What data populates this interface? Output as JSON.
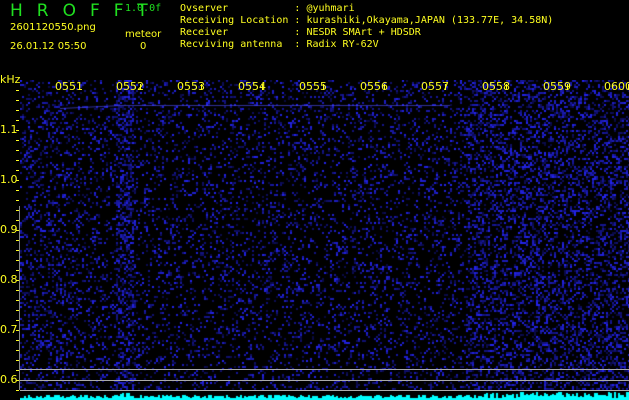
{
  "header": {
    "title": "HROFFT",
    "version": "1.0.0f",
    "filename": "2601120550.png",
    "datetime": "26.01.12 05:50",
    "meteor_label": "meteor",
    "meteor_count": "0"
  },
  "info": [
    {
      "label": "Ovserver           ",
      "value": "@yuhmari"
    },
    {
      "label": "Receiving Location ",
      "value": "kurashiki,Okayama,JAPAN (133.77E, 34.58N)"
    },
    {
      "label": "Receiver           ",
      "value": "NESDR SMArt + HDSDR"
    },
    {
      "label": "Recviving antenna  ",
      "value": "Radix RY-62V"
    }
  ],
  "axis": {
    "unit": "kHz",
    "freq_labels": [
      "1.1",
      "1.0",
      "0.9",
      "0.8",
      "0.7",
      "0.6"
    ],
    "time_labels": [
      "0551",
      "0552",
      "0553",
      "0554",
      "0555",
      "0556",
      "0557",
      "0558",
      "0559",
      "0600"
    ]
  },
  "colors": {
    "text": "#ffff20",
    "title": "#20e020",
    "noise": "#2020ff",
    "level": "#00ffff"
  }
}
